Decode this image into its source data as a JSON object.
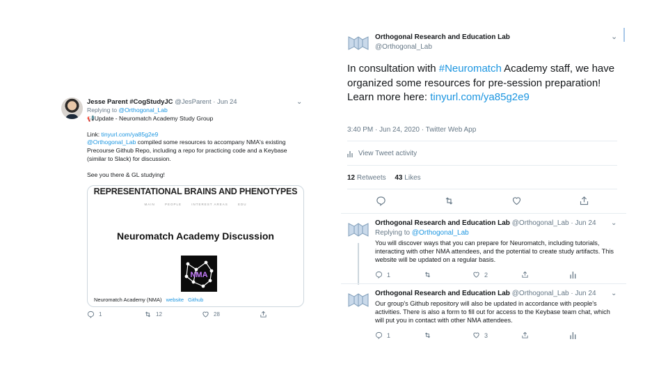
{
  "left_tweet": {
    "author_name": "Jesse Parent #CogStudyJC",
    "author_handle": "@JesParent",
    "date": "Jun 24",
    "replying_to_label": "Replying to",
    "replying_to_handle": "@Orthogonal_Lab",
    "update_emoji": "📢",
    "update_text": "Update - Neuromatch Academy Study Group",
    "link_label": "Link:",
    "link_url": "tinyurl.com/ya85g2e9",
    "mention": "@Orthogonal_Lab",
    "body_text": "compiled some resources to accompany NMA's existing Precourse Github Repo, including a repo for practicing code and a Keybase (similar to Slack) for discussion.",
    "sign_off": "See you there & GL studying!",
    "card": {
      "header": "REPRESENTATIONAL BRAINS AND PHENOTYPES",
      "nav": [
        "MAIN",
        "PEOPLE",
        "INTEREST AREAS",
        "EDU"
      ],
      "title": "Neuromatch Academy Discussion",
      "logo_text": "NMA",
      "footer_text": "Neuromatch Academy (NMA)",
      "footer_link_1": "website",
      "footer_link_2": "Github"
    },
    "reply_count": "1",
    "retweet_count": "12",
    "like_count": "28"
  },
  "main_tweet": {
    "author_name": "Orthogonal Research and Education Lab",
    "author_handle": "@Orthogonal_Lab",
    "text_prefix": "In consultation with ",
    "hashtag": "#Neuromatch",
    "text_suffix": " Academy staff, we have organized some resources for pre-session preparation! Learn more here: ",
    "link": "tinyurl.com/ya85g2e9",
    "meta": "3:40 PM · Jun 24, 2020 · Twitter Web App",
    "activity_label": "View Tweet activity",
    "retweets_count": "12",
    "retweets_label": "Retweets",
    "likes_count": "43",
    "likes_label": "Likes"
  },
  "replies": [
    {
      "author_name": "Orthogonal Research and Education Lab",
      "author_handle": "@Orthogonal_Lab",
      "date": "Jun 24",
      "replying_to_label": "Replying to",
      "replying_to_handle": "@Orthogonal_Lab",
      "text": "You will discover ways that you can prepare for Neuromatch, including tutorials, interacting with other NMA attendees, and the potential to create study artifacts. This website will be updated on a regular basis.",
      "reply_count": "1",
      "retweet_count": "",
      "like_count": "2"
    },
    {
      "author_name": "Orthogonal Research and Education Lab",
      "author_handle": "@Orthogonal_Lab",
      "date": "Jun 24",
      "text": "Our group's Github repository will also be updated in accordance with people's activities. There is also a form to fill out for access to the Keybase team chat, which will put you in contact with other NMA attendees.",
      "reply_count": "1",
      "retweet_count": "",
      "like_count": "3"
    }
  ],
  "colors": {
    "link": "#1b95e0",
    "muted": "#657786",
    "divider": "#e6ecf0"
  }
}
